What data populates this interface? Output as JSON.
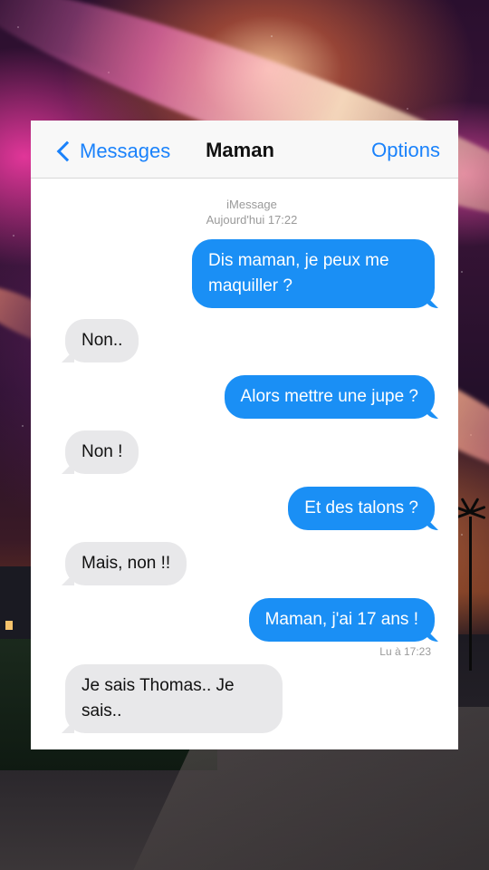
{
  "navbar": {
    "back_label": "Messages",
    "title": "Maman",
    "options_label": "Options"
  },
  "thread": {
    "service": "iMessage",
    "timestamp": "Aujourd'hui 17:22",
    "messages": [
      {
        "from": "me",
        "text": "Dis maman, je peux me maquiller ?"
      },
      {
        "from": "contact",
        "text": "Non.."
      },
      {
        "from": "me",
        "text": "Alors mettre une jupe ?"
      },
      {
        "from": "contact",
        "text": "Non !"
      },
      {
        "from": "me",
        "text": "Et des talons ?"
      },
      {
        "from": "contact",
        "text": "Mais, non !!"
      },
      {
        "from": "me",
        "text": "Maman, j'ai 17 ans !"
      },
      {
        "from": "contact",
        "text": "Je sais Thomas.. Je sais.."
      }
    ],
    "read_receipt": "Lu à 17:23"
  },
  "colors": {
    "accent": "#1a82fb",
    "outgoing_bubble": "#1a8ff5",
    "incoming_bubble": "#e8e8ea"
  }
}
